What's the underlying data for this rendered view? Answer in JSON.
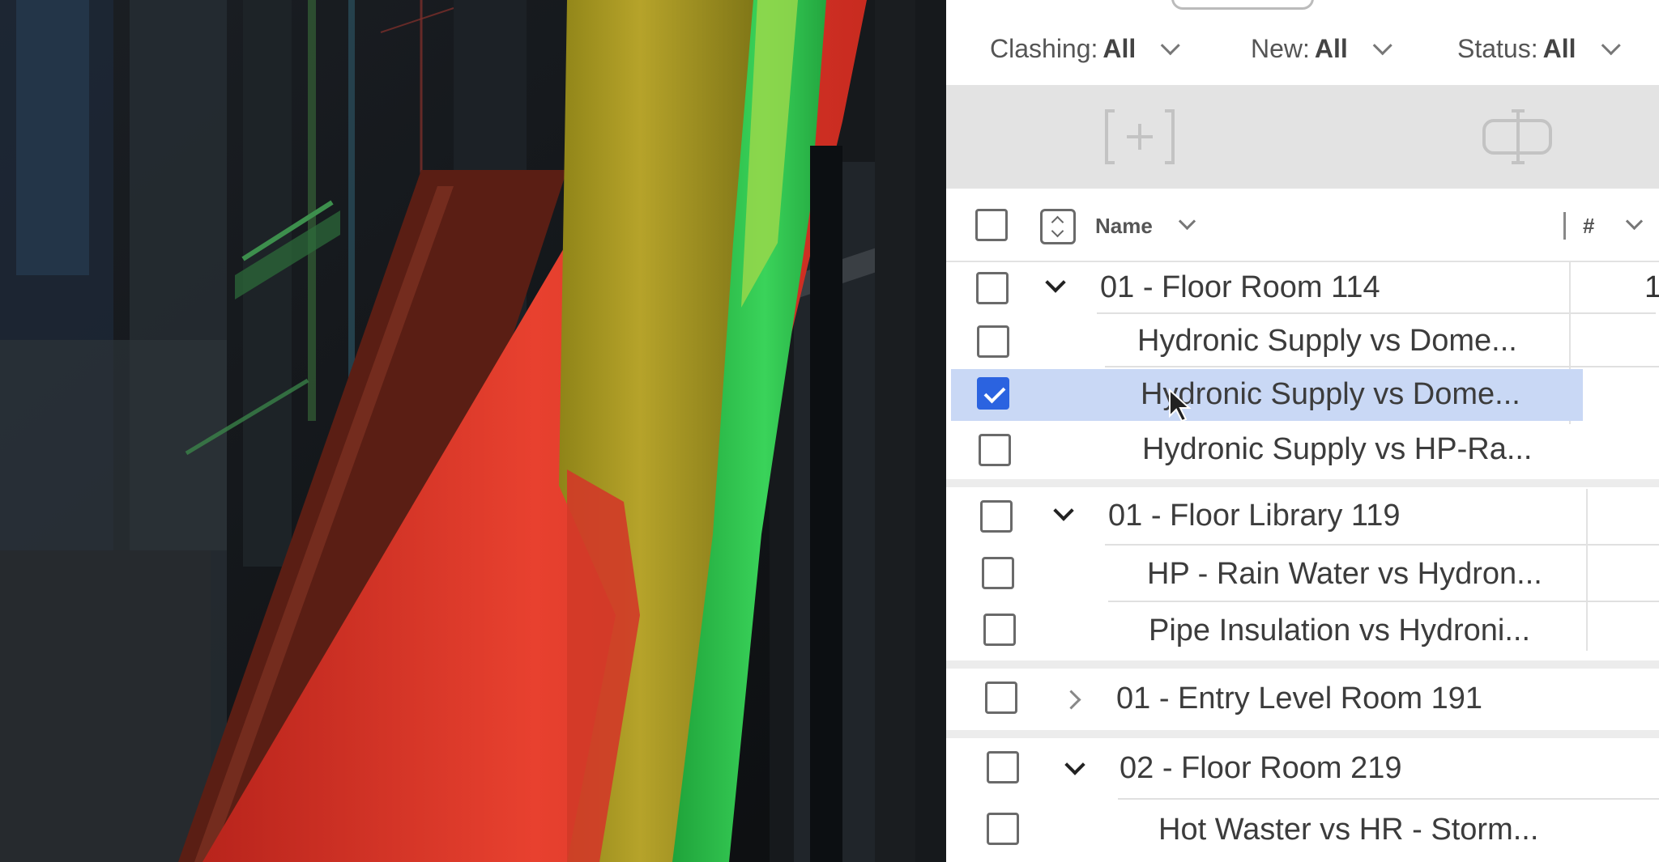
{
  "filters": [
    {
      "label": "Clashing:",
      "value": "All"
    },
    {
      "label": "New:",
      "value": "All"
    },
    {
      "label": "Status:",
      "value": "All"
    }
  ],
  "toolbar": {
    "add_icon": "add-to-group-icon",
    "split_icon": "split-group-icon",
    "add_label": "[+]"
  },
  "table_header": {
    "name": "Name",
    "count": "#"
  },
  "groups": [
    {
      "label": "01 - Floor Room 114",
      "expanded": true,
      "count": "1",
      "items": [
        {
          "label": "Hydronic Supply vs Dome...",
          "checked": false
        },
        {
          "label": "Hydronic Supply vs Dome...",
          "checked": true
        },
        {
          "label": "Hydronic Supply vs HP-Ra...",
          "checked": false
        }
      ]
    },
    {
      "label": "01 - Floor Library 119",
      "expanded": true,
      "items": [
        {
          "label": "HP - Rain Water vs Hydron...",
          "checked": false
        },
        {
          "label": "Pipe Insulation vs Hydroni...",
          "checked": false
        }
      ]
    },
    {
      "label": "01 - Entry Level Room 191",
      "expanded": false,
      "items": []
    },
    {
      "label": "02 - Floor Room 219",
      "expanded": true,
      "items": [
        {
          "label": "Hot Waster vs HR - Storm...",
          "checked": false
        }
      ]
    }
  ],
  "colors": {
    "selected_row": "#c9d8f5",
    "checkbox_checked": "#2b63e0",
    "clash_red": "#e0392c",
    "clash_yellow": "#b9a520",
    "clash_green": "#2fbf4a"
  }
}
